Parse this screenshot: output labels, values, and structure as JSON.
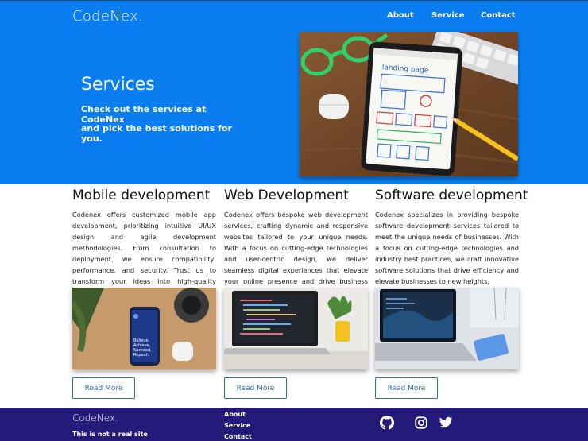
{
  "header": {
    "logo": "CodeNex.",
    "nav": [
      "About",
      "Service",
      "Contact"
    ]
  },
  "hero": {
    "title": "Services",
    "subtitle_line1": "Check out the services at CodeNex",
    "subtitle_line2": "and pick the best solutions for you.",
    "image_caption": "landing page"
  },
  "services": [
    {
      "title": "Mobile development",
      "text": "Codenex offers customized mobile app development, prioritizing intuitive UI/UX design and agile development methodologies. From consultation to deployment, we ensure compatibility, performance, and security. Trust us to transform your ideas into high-quality mobile apps that drive business growth.",
      "image_text": "Believe, Achieve, Succeed, Repeat.",
      "button": "Read More"
    },
    {
      "title": "Web Development",
      "text": "Codenex offers bespoke web development services, crafting dynamic and responsive websites tailored to your unique needs. With a focus on cutting-edge technologies and user-centric design, we deliver seamless digital experiences that elevate your online presence and drive business growth.",
      "button": "Read More"
    },
    {
      "title": "Software development",
      "text": "Codenex specializes in providing bespoke software development services tailored to meet the unique needs of businesses. With a focus on cutting-edge technologies and industry best practices, we craft innovative software solutions that drive efficiency and elevate businesses to new heights.",
      "button": "Read More"
    }
  ],
  "footer": {
    "logo": "CodeNex.",
    "note": "This is not a real site",
    "links": [
      "About",
      "Service",
      "Contact"
    ],
    "icons": [
      "github-icon",
      "instagram-icon",
      "twitter-icon"
    ]
  }
}
